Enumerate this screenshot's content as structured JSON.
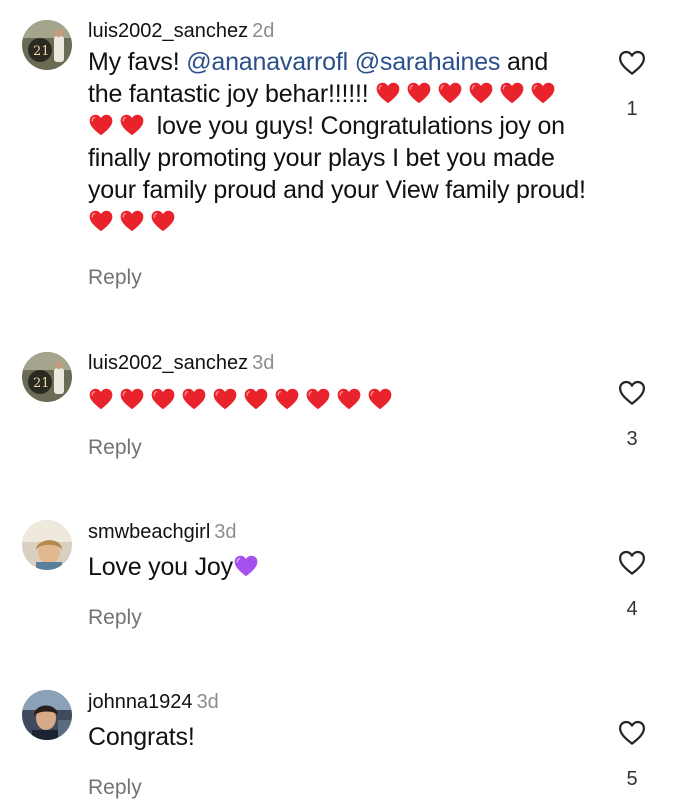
{
  "colors": {
    "text": "#111111",
    "muted": "#8e8e8e",
    "mention": "#2b4f8a",
    "red_heart": "#e8232c",
    "purple_heart": "#a64ff0"
  },
  "comments": [
    {
      "username": "luis2002_sanchez",
      "time": "2d",
      "text_parts": {
        "p1": "My favs! ",
        "mention1": "@ananavarrofl",
        "sp": " ",
        "mention2": "@sarahaines",
        "p2": " and the fantastic joy behar!!!!!! ",
        "p3": " love you guys! Congratulations joy on finally promoting your plays I bet you made your family proud and your View family proud!"
      },
      "emoji": "red-heart",
      "reply_label": "Reply",
      "like_count": "1",
      "like_icon": "heart-outline-icon"
    },
    {
      "username": "luis2002_sanchez",
      "time": "3d",
      "text": "",
      "emoji": "red-heart",
      "reply_label": "Reply",
      "like_count": "3",
      "like_icon": "heart-outline-icon"
    },
    {
      "username": "smwbeachgirl",
      "time": "3d",
      "text": "Love you Joy",
      "emoji": "purple-heart",
      "reply_label": "Reply",
      "like_count": "4",
      "like_icon": "heart-outline-icon"
    },
    {
      "username": "johnna1924",
      "time": "3d",
      "text": "Congrats!",
      "reply_label": "Reply",
      "like_count": "5",
      "like_icon": "heart-outline-icon"
    }
  ]
}
